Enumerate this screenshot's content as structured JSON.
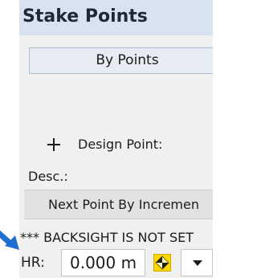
{
  "header": {
    "title": "Stake Points"
  },
  "main": {
    "by_points_label": "By Points",
    "design_point": {
      "icon": "plus-icon",
      "label": "Design Point:"
    },
    "desc_label": "Desc.:",
    "next_point_label": "Next Point By Incremen",
    "backsight_warning": "*** BACKSIGHT IS NOT SET",
    "hr": {
      "label": "HR:",
      "value": "0.000 m"
    },
    "target_icon": "target-icon",
    "dropdown_icon": "chevron-down-icon"
  },
  "colors": {
    "header_bg": "#d9e3ef",
    "panel_bg": "#f0f0f0",
    "target_yellow": "#ffd800",
    "arrow_blue": "#1f6fd1"
  }
}
